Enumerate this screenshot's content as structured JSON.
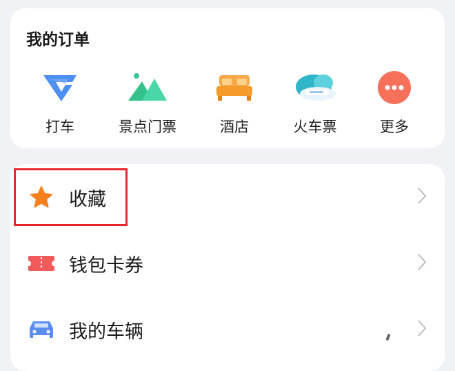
{
  "orders": {
    "title": "我的订单",
    "items": [
      {
        "label": "打车",
        "icon": "taxi-logo-icon"
      },
      {
        "label": "景点门票",
        "icon": "mountain-icon"
      },
      {
        "label": "酒店",
        "icon": "bed-icon"
      },
      {
        "label": "火车票",
        "icon": "train-cloud-icon"
      },
      {
        "label": "更多",
        "icon": "more-dots-icon"
      }
    ]
  },
  "menu": {
    "items": [
      {
        "label": "收藏",
        "icon": "star-icon"
      },
      {
        "label": "钱包卡券",
        "icon": "ticket-icon"
      },
      {
        "label": "我的车辆",
        "icon": "car-icon"
      }
    ]
  },
  "colors": {
    "highlight_border": "#e8262d",
    "star": "#f6801e",
    "ticket": "#f05a5a",
    "car": "#5b8def",
    "more": "#f6705a"
  }
}
